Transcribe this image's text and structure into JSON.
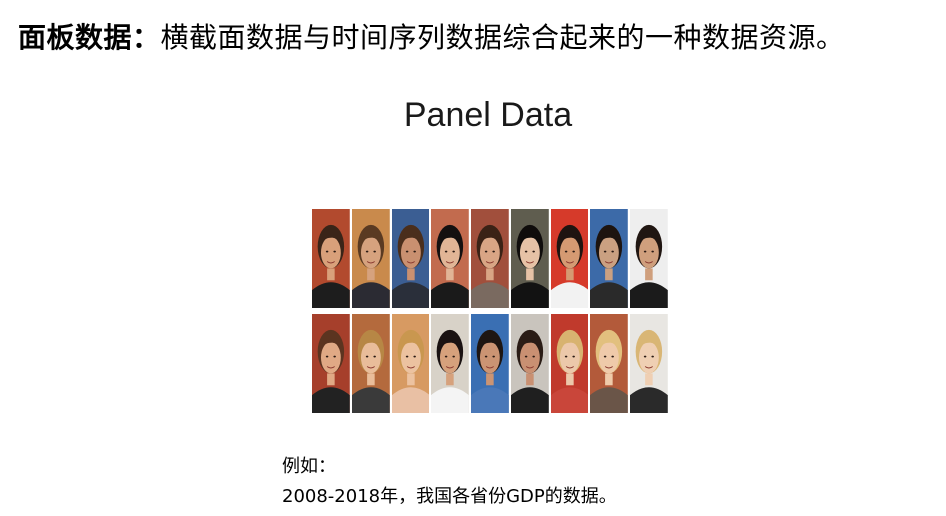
{
  "heading": {
    "term": "面板数据：",
    "definition": "横截面数据与时间序列数据综合起来的一种数据资源。"
  },
  "slide_title": "Panel Data",
  "portraits": [
    {
      "bg": "#b24a2e",
      "skin": "#d9a07a",
      "hair": "#3a2418",
      "shirt": "#1d1d1d"
    },
    {
      "bg": "#c98a4c",
      "skin": "#d6a27e",
      "hair": "#5a3a22",
      "shirt": "#2b2b33"
    },
    {
      "bg": "#3b5e93",
      "skin": "#c99070",
      "hair": "#4a2e1c",
      "shirt": "#2a2f3a"
    },
    {
      "bg": "#c26b4e",
      "skin": "#e1b596",
      "hair": "#141010",
      "shirt": "#1a1a1a"
    },
    {
      "bg": "#a14f3c",
      "skin": "#d9a585",
      "hair": "#3b2216",
      "shirt": "#7a6a60"
    },
    {
      "bg": "#5f5d4f",
      "skin": "#e6c2a6",
      "hair": "#0f0c0b",
      "shirt": "#121212"
    },
    {
      "bg": "#d63a2a",
      "skin": "#d59a72",
      "hair": "#1f1410",
      "shirt": "#f2f2f2"
    },
    {
      "bg": "#3c6aa8",
      "skin": "#caa081",
      "hair": "#1d1410",
      "shirt": "#2a2a2a"
    },
    {
      "bg": "#eeeeee",
      "skin": "#cf9f7d",
      "hair": "#201612",
      "shirt": "#1b1b1b"
    },
    {
      "bg": "#a63f2b",
      "skin": "#e0a985",
      "hair": "#5b3420",
      "shirt": "#222222"
    },
    {
      "bg": "#b46a3d",
      "skin": "#e9bd9a",
      "hair": "#b78745",
      "shirt": "#3a3a3a"
    },
    {
      "bg": "#d79a62",
      "skin": "#ecc2a0",
      "hair": "#c9974f",
      "shirt": "#e9c0a4"
    },
    {
      "bg": "#d8d2c8",
      "skin": "#d6a17c",
      "hair": "#1a1212",
      "shirt": "#f4f4f4"
    },
    {
      "bg": "#3a6fb3",
      "skin": "#cb9473",
      "hair": "#1e1612",
      "shirt": "#4a78b8"
    },
    {
      "bg": "#c9c4bd",
      "skin": "#c99072",
      "hair": "#2a1c16",
      "shirt": "#1f1f1f"
    },
    {
      "bg": "#c03a2c",
      "skin": "#ecc8aa",
      "hair": "#d8b370",
      "shirt": "#c9463a"
    },
    {
      "bg": "#b35a3a",
      "skin": "#efcaaa",
      "hair": "#e2c07e",
      "shirt": "#6a5548"
    },
    {
      "bg": "#e8e6e2",
      "skin": "#efcfb3",
      "hair": "#d9b675",
      "shirt": "#2a2a2a"
    }
  ],
  "caption": {
    "line1": "例如：",
    "line2": "2008-2018年，我国各省份GDP的数据。"
  }
}
